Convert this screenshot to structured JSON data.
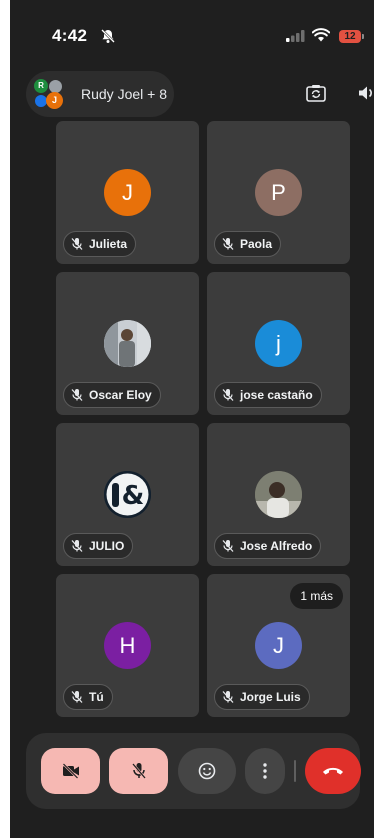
{
  "status_bar": {
    "time": "4:42",
    "battery": "12"
  },
  "call_header": {
    "title": "Rudy Joel + 8",
    "avatar_initials": [
      "R",
      "J"
    ]
  },
  "participants": [
    {
      "name": "Julieta",
      "initial": "J",
      "avatar_color": "#e8710a",
      "muted": true
    },
    {
      "name": "Paola",
      "initial": "P",
      "avatar_color": "#8d6e63",
      "muted": true
    },
    {
      "name": "Oscar Eloy",
      "initial": "",
      "avatar_color": "#9aa0a6",
      "photo": true,
      "muted": true
    },
    {
      "name": "jose castaño",
      "initial": "j",
      "avatar_color": "#1a8cd8",
      "muted": true
    },
    {
      "name": "JULIO",
      "initial": "",
      "avatar_color": "#e8eaed",
      "logo": true,
      "muted": true
    },
    {
      "name": "Jose Alfredo",
      "initial": "",
      "avatar_color": "#6d6d5f",
      "photo": true,
      "muted": true
    },
    {
      "name": "Tú",
      "initial": "H",
      "avatar_color": "#7b1fa2",
      "muted": true
    },
    {
      "name": "Jorge Luis",
      "initial": "J",
      "avatar_color": "#5c6bc0",
      "muted": true
    }
  ],
  "overflow_badge": "1 más",
  "colors": {
    "background": "#1f1f1f",
    "tile": "#3c3c3c",
    "end_call": "#e0302a",
    "toggle_off": "#f6b8b3"
  },
  "icons": {
    "bell_off": "bell-off-icon",
    "signal": "signal-icon",
    "wifi": "wifi-icon",
    "flip_camera": "flip-camera-icon",
    "speaker": "speaker-icon",
    "mic_off": "mic-off-icon",
    "camera_off": "camera-off-icon",
    "emoji": "emoji-icon",
    "more": "more-vertical-icon",
    "end_call": "end-call-icon"
  }
}
